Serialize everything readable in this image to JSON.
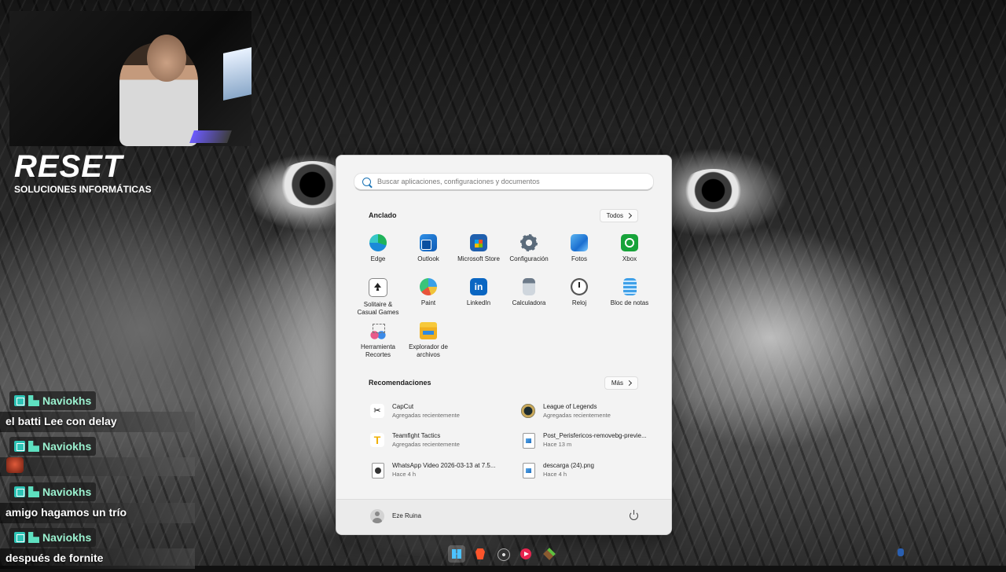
{
  "overlay": {
    "brand_title": "RESET",
    "brand_subtitle": "SOLUCIONES INFORMÁTICAS"
  },
  "chat": {
    "messages": [
      {
        "user": "Naviokhs",
        "text": "el batti Lee con delay"
      },
      {
        "user": "Naviokhs",
        "text": "",
        "emote": "pepe-emote-icon"
      },
      {
        "user": "Naviokhs",
        "text": "amigo hagamos un trío"
      },
      {
        "user": "Naviokhs",
        "text": "después de fornite"
      }
    ]
  },
  "start_menu": {
    "search_placeholder": "Buscar aplicaciones, configuraciones y documentos",
    "pinned_title": "Anclado",
    "all_button": "Todos",
    "pinned": [
      {
        "label": "Edge",
        "icon": "edge-icon"
      },
      {
        "label": "Outlook",
        "icon": "outlook-icon"
      },
      {
        "label": "Microsoft Store",
        "icon": "store-icon"
      },
      {
        "label": "Configuración",
        "icon": "settings-gear-icon"
      },
      {
        "label": "Fotos",
        "icon": "photos-icon"
      },
      {
        "label": "Xbox",
        "icon": "xbox-icon"
      },
      {
        "label": "Solitaire & Casual Games",
        "icon": "solitaire-icon"
      },
      {
        "label": "Paint",
        "icon": "paint-icon"
      },
      {
        "label": "LinkedIn",
        "icon": "linkedin-icon"
      },
      {
        "label": "Calculadora",
        "icon": "calculator-icon"
      },
      {
        "label": "Reloj",
        "icon": "clock-icon"
      },
      {
        "label": "Bloc de notas",
        "icon": "notepad-icon"
      },
      {
        "label": "Herramienta Recortes",
        "icon": "snipping-tool-icon"
      },
      {
        "label": "Explorador de archivos",
        "icon": "file-explorer-icon"
      }
    ],
    "recommended_title": "Recomendaciones",
    "more_button": "Más",
    "recommended": [
      {
        "title": "CapCut",
        "subtitle": "Agregadas recientemente",
        "icon": "capcut-icon"
      },
      {
        "title": "League of Legends",
        "subtitle": "Agregadas recientemente",
        "icon": "league-of-legends-icon"
      },
      {
        "title": "Teamfight Tactics",
        "subtitle": "Agregadas recientemente",
        "icon": "teamfight-tactics-icon"
      },
      {
        "title": "Post_Perisfericos-removebg-previe...",
        "subtitle": "Hace 13 m",
        "icon": "image-file-icon"
      },
      {
        "title": "WhatsApp Video 2026-03-13 at 7.5...",
        "subtitle": "Hace 4 h",
        "icon": "video-file-icon"
      },
      {
        "title": "descarga (24).png",
        "subtitle": "Hace 4 h",
        "icon": "image-file-icon"
      }
    ],
    "user_name": "Eze Ruina"
  },
  "taskbar": {
    "items": [
      {
        "name": "start-button",
        "icon": "windows-logo-icon"
      },
      {
        "name": "brave-taskbar-button",
        "icon": "brave-icon"
      },
      {
        "name": "obs-taskbar-button",
        "icon": "obs-icon"
      },
      {
        "name": "media-player-taskbar-button",
        "icon": "media-player-icon"
      },
      {
        "name": "minecraft-taskbar-button",
        "icon": "minecraft-icon"
      }
    ]
  }
}
